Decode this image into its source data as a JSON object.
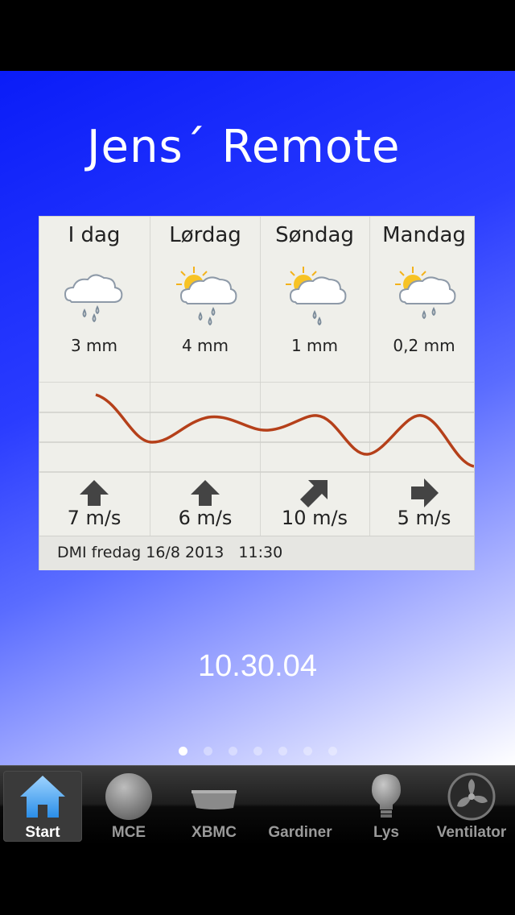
{
  "app_title": "Jens´ Remote",
  "weather": {
    "days": [
      {
        "name": "I dag",
        "icon": "rain-cloud-icon",
        "rain": "3 mm",
        "wind": "7 m/s",
        "wind_dir": "north-arrow-icon"
      },
      {
        "name": "Lørdag",
        "icon": "sun-rain-cloud-icon",
        "rain": "4 mm",
        "wind": "6 m/s",
        "wind_dir": "north-arrow-icon"
      },
      {
        "name": "Søndag",
        "icon": "sun-rain-cloud-icon",
        "rain": "1 mm",
        "wind": "10 m/s",
        "wind_dir": "northeast-arrow-icon"
      },
      {
        "name": "Mandag",
        "icon": "sun-rain-cloud-icon",
        "rain": "0,2 mm",
        "wind": "5 m/s",
        "wind_dir": "east-arrow-icon"
      }
    ],
    "footer": "DMI fredag 16/8 2013   11:30",
    "temperature_line_color": "#b5401a"
  },
  "clock": "10.30.04",
  "pager": {
    "count": 7,
    "active": 0
  },
  "tabs": [
    {
      "label": "Start",
      "icon": "home-icon",
      "active": true
    },
    {
      "label": "MCE",
      "icon": "circle-icon",
      "active": false
    },
    {
      "label": "XBMC",
      "icon": "xbmc-box-icon",
      "active": false
    },
    {
      "label": "Gardiner",
      "icon": "curtain-icon",
      "active": false
    },
    {
      "label": "Lys",
      "icon": "bulb-icon",
      "active": false
    },
    {
      "label": "Ventilator",
      "icon": "fan-icon",
      "active": false
    }
  ]
}
